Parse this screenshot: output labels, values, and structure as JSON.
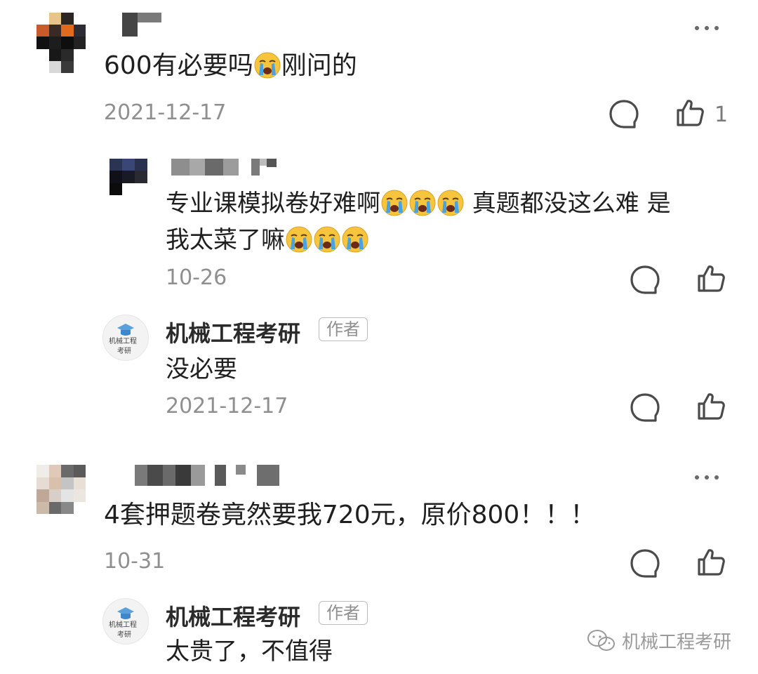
{
  "comments": [
    {
      "text_a": "600有必要吗",
      "text_b": "刚问的",
      "date": "2021-12-17",
      "like_count": "1",
      "replies": [
        {
          "line1": "专业课模拟卷好难啊",
          "line1_tail": " 真题都没这么难 是",
          "line2": "我太菜了嘛",
          "date": "10-26"
        },
        {
          "author": "机械工程考研",
          "badge": "作者",
          "text": "没必要",
          "date": "2021-12-17"
        }
      ]
    },
    {
      "text": "4套押题卷竟然要我720元，原价800！！！",
      "date": "10-31",
      "replies": [
        {
          "author": "机械工程考研",
          "badge": "作者",
          "text": "太贵了，不值得"
        }
      ]
    }
  ],
  "logo_lettering": "机械工程考研",
  "watermark": "机械工程考研",
  "colors": {
    "date": "#8f8f8f",
    "icon": "#4a4a4a",
    "emoji_face": "#f6c53d",
    "emoji_tear": "#4aa3e0"
  }
}
